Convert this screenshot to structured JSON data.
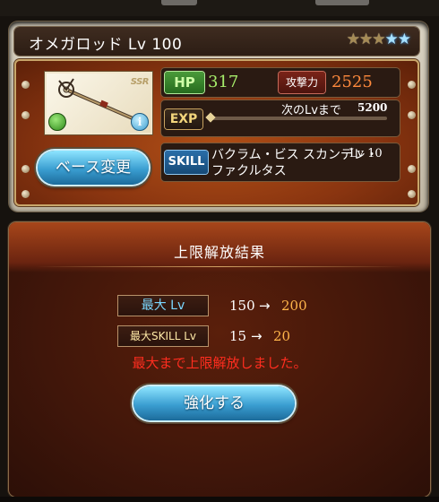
{
  "weapon": {
    "name": "オメガロッド Lv 100",
    "rarity": "SSR",
    "stars": {
      "gold": 3,
      "blue": 2
    },
    "element_icon": "wind-element-icon",
    "info_icon": "info-icon"
  },
  "stats": {
    "hp_label": "HP",
    "hp_value": "317",
    "atk_label": "攻撃力",
    "atk_value": "2525",
    "exp_label": "EXP",
    "exp_caption": "次のLvまで",
    "exp_value": "5200",
    "exp_progress": 0,
    "skill_label": "SKILL",
    "skill_name": "バクラム・ビス スカンデレ・ファクルタス",
    "skill_level": "Lv 10"
  },
  "base_button_label": "ベース変更",
  "result": {
    "title": "上限解放結果",
    "max_lv_label": "最大 Lv",
    "max_lv_old": "150",
    "max_lv_new": "200",
    "max_skill_label": "最大SKILL Lv",
    "max_skill_old": "15",
    "max_skill_new": "20",
    "arrow": "→",
    "message": "最大まで上限解放しました。",
    "enhance_button_label": "強化する"
  },
  "colors": {
    "hp": "#a7ee6b",
    "attack": "#ff8a3d",
    "new_value": "#ffb54a",
    "message": "#ff2d1f",
    "button": "#3a9ed1"
  }
}
